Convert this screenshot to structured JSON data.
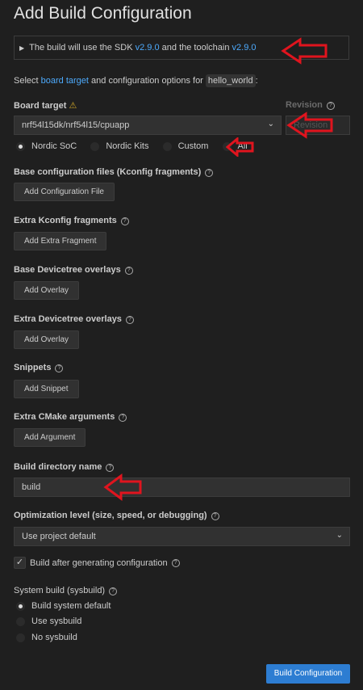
{
  "title": "Add Build Configuration",
  "sdk_info": {
    "prefix": "The build will use the SDK",
    "sdk_version": "v2.9.0",
    "middle": "and the toolchain",
    "toolchain_version": "v2.9.0"
  },
  "intro": {
    "prefix": "Select",
    "link": "board target",
    "middle": "and configuration options for",
    "app": "hello_world",
    "suffix": ":"
  },
  "board_target": {
    "label": "Board target",
    "value": "nrf54l15dk/nrf54l15/cpuapp",
    "revision_label": "Revision",
    "revision_placeholder": "Revision",
    "filters": [
      {
        "label": "Nordic SoC",
        "selected": true
      },
      {
        "label": "Nordic Kits",
        "selected": false
      },
      {
        "label": "Custom",
        "selected": false
      },
      {
        "label": "All",
        "selected": false
      }
    ]
  },
  "sections": [
    {
      "label": "Base configuration files (Kconfig fragments)",
      "button": "Add Configuration File"
    },
    {
      "label": "Extra Kconfig fragments",
      "button": "Add Extra Fragment"
    },
    {
      "label": "Base Devicetree overlays",
      "button": "Add Overlay"
    },
    {
      "label": "Extra Devicetree overlays",
      "button": "Add Overlay"
    },
    {
      "label": "Snippets",
      "button": "Add Snippet"
    },
    {
      "label": "Extra CMake arguments",
      "button": "Add Argument"
    }
  ],
  "build_dir": {
    "label": "Build directory name",
    "value": "build"
  },
  "optimization": {
    "label": "Optimization level (size, speed, or debugging)",
    "value": "Use project default"
  },
  "build_after": {
    "label": "Build after generating configuration",
    "checked": true
  },
  "sysbuild": {
    "label": "System build (sysbuild)",
    "options": [
      {
        "label": "Build system default",
        "selected": true
      },
      {
        "label": "Use sysbuild",
        "selected": false
      },
      {
        "label": "No sysbuild",
        "selected": false
      }
    ]
  },
  "submit": "Build Configuration"
}
